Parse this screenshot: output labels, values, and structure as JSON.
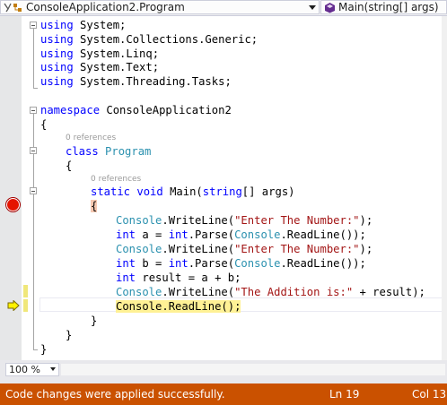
{
  "nav": {
    "class_combo": "ConsoleApplication2.Program",
    "member_combo": "Main(string[] args)"
  },
  "editor": {
    "code_lens_class": "0 references",
    "code_lens_method": "0 references",
    "lines": {
      "l1": [
        "using",
        " System;"
      ],
      "l2": [
        "using",
        " System.Collections.Generic;"
      ],
      "l3": [
        "using",
        " System.Linq;"
      ],
      "l4": [
        "using",
        " System.Text;"
      ],
      "l5": [
        "using",
        " System.Threading.Tasks;"
      ],
      "l7": [
        "namespace",
        " ConsoleApplication2"
      ],
      "l8": "{",
      "l9": [
        "class",
        " ",
        "Program"
      ],
      "l10": "{",
      "l11": [
        "static",
        " ",
        "void",
        " Main(",
        "string",
        "[] args)"
      ],
      "l12": "{",
      "l13": [
        "Console",
        ".WriteLine(",
        "\"Enter The Number:\"",
        ");"
      ],
      "l14": [
        "int",
        " a = ",
        "int",
        ".Parse(",
        "Console",
        ".ReadLine());"
      ],
      "l15": [
        "Console",
        ".WriteLine(",
        "\"Enter The Number:\"",
        ");"
      ],
      "l16": [
        "int",
        " b = ",
        "int",
        ".Parse(",
        "Console",
        ".ReadLine());"
      ],
      "l17": [
        "int",
        " result = a + b;"
      ],
      "l18": [
        "Console",
        ".WriteLine(",
        "\"The Addition is:\"",
        " + result);"
      ],
      "l19": [
        "Console",
        ".ReadLine();"
      ],
      "l20": "}",
      "l21": "}",
      "l22": "}"
    }
  },
  "zoom": "100 %",
  "status": {
    "message": "Code changes were applied successfully.",
    "line": "Ln 19",
    "col": "Col 13"
  },
  "colors": {
    "keyword": "#0000ff",
    "type": "#2b91af",
    "string": "#a31515",
    "status_bar": "#ca5100",
    "breakpoint": "#e51400",
    "current_statement": "#fff195"
  }
}
